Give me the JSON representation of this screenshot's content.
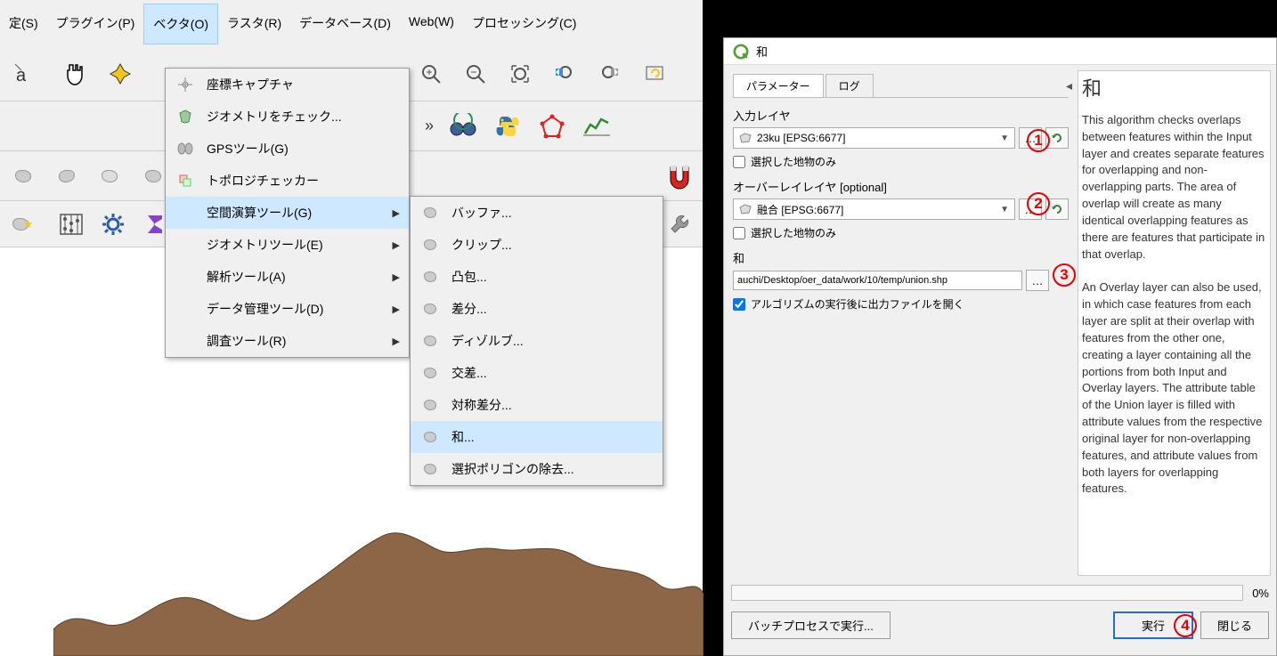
{
  "menubar": {
    "items": [
      {
        "label": "定(S)"
      },
      {
        "label": "プラグイン(P)"
      },
      {
        "label": "ベクタ(O)"
      },
      {
        "label": "ラスタ(R)"
      },
      {
        "label": "データベース(D)"
      },
      {
        "label": "Web(W)"
      },
      {
        "label": "プロセッシング(C)"
      }
    ]
  },
  "vector_menu": {
    "items": [
      {
        "label": "座標キャプチャ"
      },
      {
        "label": "ジオメトリをチェック..."
      },
      {
        "label": "GPSツール(G)"
      },
      {
        "label": "トポロジチェッカー"
      },
      {
        "label": "空間演算ツール(G)",
        "submenu": true,
        "highlighted": true
      },
      {
        "label": "ジオメトリツール(E)",
        "submenu": true
      },
      {
        "label": "解析ツール(A)",
        "submenu": true
      },
      {
        "label": "データ管理ツール(D)",
        "submenu": true
      },
      {
        "label": "調査ツール(R)",
        "submenu": true
      }
    ]
  },
  "geoprocessing_submenu": {
    "items": [
      {
        "label": "バッファ..."
      },
      {
        "label": "クリップ..."
      },
      {
        "label": "凸包..."
      },
      {
        "label": "差分..."
      },
      {
        "label": "ディゾルブ..."
      },
      {
        "label": "交差..."
      },
      {
        "label": "対称差分..."
      },
      {
        "label": "和...",
        "highlighted": true
      },
      {
        "label": "選択ポリゴンの除去..."
      }
    ]
  },
  "dialog": {
    "title": "和",
    "tabs": {
      "params": "パラメーター",
      "log": "ログ"
    },
    "input_layer_label": "入力レイヤ",
    "input_layer_value": "23ku [EPSG:6677]",
    "selected_only_1": "選択した地物のみ",
    "overlay_layer_label": "オーバーレイレイヤ [optional]",
    "overlay_layer_value": "融合 [EPSG:6677]",
    "selected_only_2": "選択した地物のみ",
    "output_label": "和",
    "output_value": "auchi/Desktop/oer_data/work/10/temp/union.shp",
    "open_after_label": "アルゴリズムの実行後に出力ファイルを開く",
    "help_heading": "和",
    "help_p1": "This algorithm checks overlaps between features within the Input layer and creates separate features for overlapping and non-overlapping parts. The area of overlap will create as many identical overlapping features as there are features that participate in that overlap.",
    "help_p2": "An Overlay layer can also be used, in which case features from each layer are split at their overlap with features from the other one, creating a layer containing all the portions from both Input and Overlay layers. The attribute table of the Union layer is filled with attribute values from the respective original layer for non-overlapping features, and attribute values from both layers for overlapping features.",
    "progress_pct": "0%",
    "batch_btn": "バッチプロセスで実行...",
    "run_btn": "実行",
    "close_btn": "閉じる"
  },
  "annotations": {
    "a1": "1",
    "a2": "2",
    "a3": "3",
    "a4": "4"
  }
}
